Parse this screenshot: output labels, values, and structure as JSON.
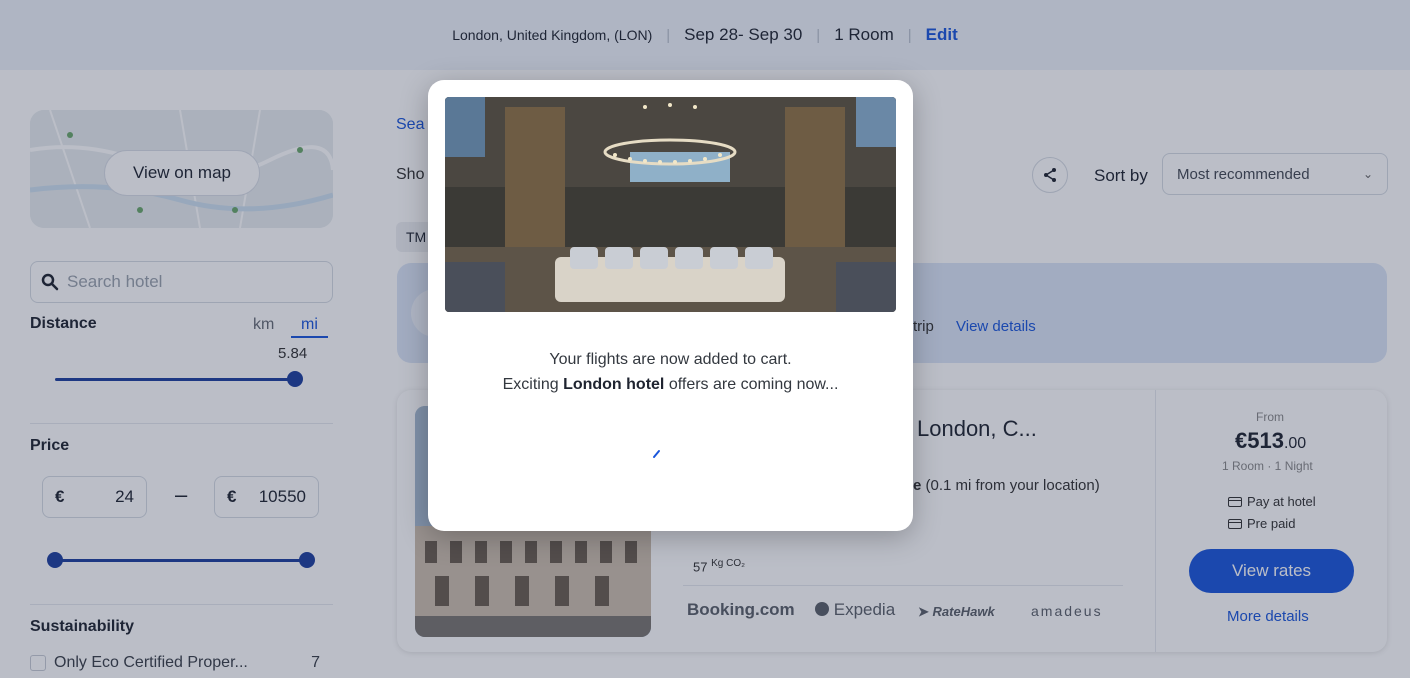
{
  "topbar": {
    "location": "London, United Kingdom, (LON)",
    "dates": "Sep 28- Sep 30",
    "rooms": "1 Room",
    "edit_label": "Edit"
  },
  "sidebar": {
    "map_button_label": "View on map",
    "search_placeholder": "Search hotel",
    "distance_label": "Distance",
    "unit_km": "km",
    "unit_mi": "mi",
    "distance_value": "5.84",
    "price_label": "Price",
    "price_currency": "€",
    "price_min": "24",
    "price_max": "10550",
    "price_separator": "–",
    "sustainability_label": "Sustainability",
    "eco_filter_label": "Only Eco Certified Proper...",
    "eco_filter_count": "7"
  },
  "main": {
    "breadcrumb_fragment": "Sea",
    "showing_fragment": "Sho",
    "chip_fragment": "TM",
    "sort_label": "Sort by",
    "sort_value": "Most recommended",
    "banner_trip_text": "trip",
    "banner_details_label": "View details"
  },
  "hotel_card": {
    "name_fragment": "London, C...",
    "distance_bold": "e",
    "distance_text": " (0.1 mi from your location)",
    "co2_value": "57",
    "co2_unit": "Kg CO₂",
    "providers": [
      "Booking.com",
      "Expedia",
      "RateHawk",
      "amadeus"
    ],
    "from_label": "From",
    "price_whole": "€513",
    "price_decimal": ".00",
    "room_night": "1 Room · 1 Night",
    "pay_at_hotel": "Pay at hotel",
    "pre_paid": "Pre paid",
    "view_rates_label": "View rates",
    "more_details_label": "More details"
  },
  "modal": {
    "line1": "Your flights are now added to cart.",
    "line2_prefix": "Exciting ",
    "line2_bold": "London hotel",
    "line2_suffix": " offers are coming now..."
  },
  "colors": {
    "accent": "#1a56db",
    "slider": "#1d3f9e",
    "topbar_bg": "#eef2f9",
    "banner_bg": "#dbe6f7"
  }
}
